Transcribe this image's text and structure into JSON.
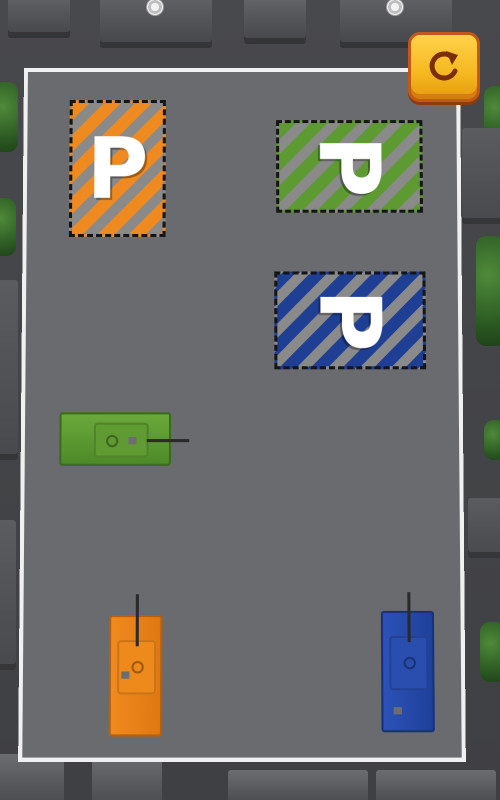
{
  "game": {
    "restart_icon": "restart-icon",
    "colors": {
      "orange": "#ee8a1f",
      "green": "#5e9a32",
      "blue": "#1e3f94",
      "button": "#f5b820"
    }
  },
  "parking_spots": [
    {
      "color": "orange",
      "label": "P"
    },
    {
      "color": "green",
      "label": "P"
    },
    {
      "color": "blue",
      "label": "P"
    }
  ],
  "tanks": [
    {
      "color": "green",
      "facing": "right"
    },
    {
      "color": "orange",
      "facing": "up"
    },
    {
      "color": "blue",
      "facing": "up"
    }
  ]
}
